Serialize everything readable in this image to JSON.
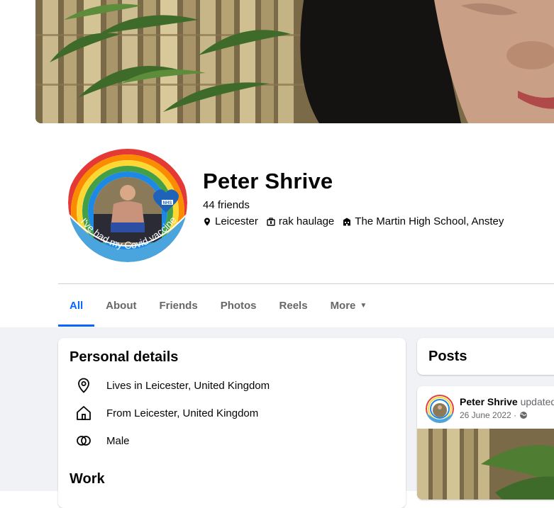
{
  "profile": {
    "name": "Peter Shrive",
    "friends": "44 friends",
    "location": "Leicester",
    "work": "rak haulage",
    "school": "The Martin High School, Anstey",
    "avatar_badge_text": "I've had my Covid vaccine"
  },
  "tabs": [
    {
      "label": "All",
      "active": true
    },
    {
      "label": "About"
    },
    {
      "label": "Friends"
    },
    {
      "label": "Photos"
    },
    {
      "label": "Reels"
    },
    {
      "label": "More"
    }
  ],
  "details": {
    "title": "Personal details",
    "lives_in": "Lives in Leicester, United Kingdom",
    "from": "From Leicester, United Kingdom",
    "gender": "Male",
    "work_title": "Work"
  },
  "posts": {
    "title": "Posts",
    "post_author": "Peter Shrive",
    "post_action": " updated",
    "post_date": "26 June 2022 ·"
  },
  "icons": {
    "location": "map-pin-icon",
    "work": "briefcase-icon",
    "school": "school-icon",
    "home": "home-icon",
    "gender": "gender-icon",
    "globe": "globe-icon"
  },
  "colors": {
    "accent": "#0866ff",
    "muted_text": "#65676b",
    "page_bg": "#f0f2f5"
  }
}
